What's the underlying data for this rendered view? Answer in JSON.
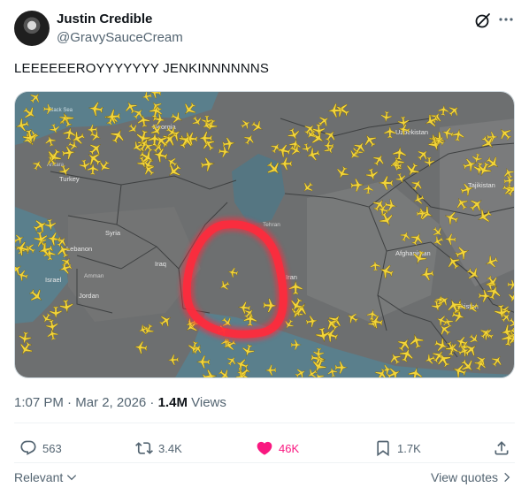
{
  "author": {
    "name": "Justin Credible",
    "handle": "@GravySauceCream"
  },
  "tweet": {
    "text": "LEEEEEEROYYYYYYY JENKINNNNNNS"
  },
  "map": {
    "labels": {
      "georgia": "Georgia",
      "turkey": "Turkey",
      "ankara": "Ankara",
      "syria": "Syria",
      "lebanon": "Lebanon",
      "israel": "Israel",
      "amman": "Amman",
      "jordan": "Jordan",
      "iraq": "Iraq",
      "iran": "Iran",
      "tehran": "Tehran",
      "uzbekistan": "Uzbekistan",
      "tajikistan": "Tajikistan",
      "afghanistan": "Afghanistan",
      "pakistan": "Pakistan",
      "black_sea": "Black Sea"
    }
  },
  "meta": {
    "time": "1:07 PM",
    "sep1": " · ",
    "date": "Mar 2, 2026",
    "sep2": " · ",
    "views_count": "1.4M",
    "views_label": " Views"
  },
  "actions": {
    "replies": "563",
    "reposts": "3.4K",
    "likes": "46K",
    "bookmarks": "1.7K"
  },
  "footer": {
    "sort_label": "Relevant",
    "view_quotes": "View quotes"
  },
  "colors": {
    "like_pink": "#f91880",
    "secondary_text": "#536471",
    "plane_yellow": "#f2d43a",
    "circle_red": "#ff2a3c"
  }
}
